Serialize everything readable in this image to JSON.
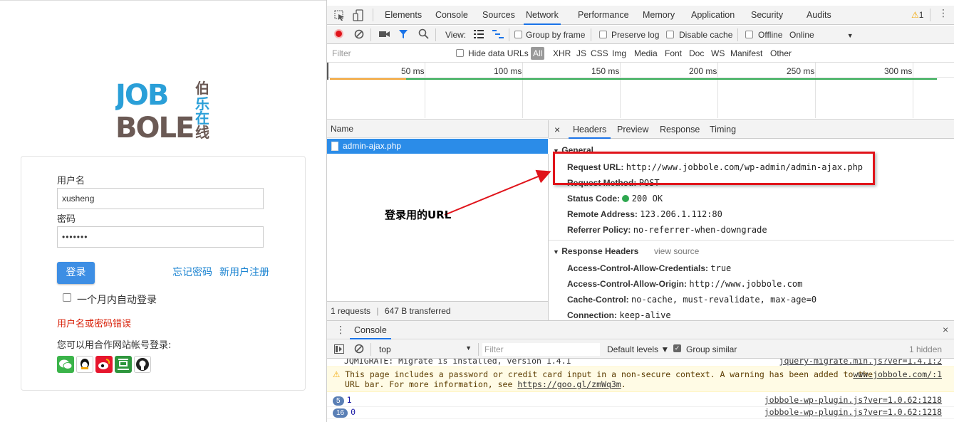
{
  "login": {
    "logo": {
      "line1": "JOB",
      "line2": "BOLE",
      "cn1": "伯乐",
      "cn2": "在线"
    },
    "username_label": "用户名",
    "username_value": "xusheng",
    "password_label": "密码",
    "password_value": "•••••••",
    "login_button": "登录",
    "forgot_link": "忘记密码",
    "register_link": "新用户注册",
    "remember_label": "一个月内自动登录",
    "error_message": "用户名或密码错误",
    "partner_label": "您可以用合作网站帐号登录:",
    "social_icons": [
      "wechat-icon",
      "qq-icon",
      "weibo-icon",
      "douban-icon",
      "github-icon"
    ]
  },
  "devtools": {
    "tabs": [
      "Elements",
      "Console",
      "Sources",
      "Network",
      "Performance",
      "Memory",
      "Application",
      "Security",
      "Audits"
    ],
    "active_tab": "Network",
    "warning_count": "1",
    "toolbar": {
      "view_label": "View:",
      "group_by_frame": "Group by frame",
      "preserve_log": "Preserve log",
      "disable_cache": "Disable cache",
      "offline": "Offline",
      "throttle": "Online"
    },
    "filter_bar": {
      "placeholder": "Filter",
      "hide_data_urls": "Hide data URLs",
      "types": [
        "All",
        "XHR",
        "JS",
        "CSS",
        "Img",
        "Media",
        "Font",
        "Doc",
        "WS",
        "Manifest",
        "Other"
      ]
    },
    "timeline_ticks": [
      "50 ms",
      "100 ms",
      "150 ms",
      "200 ms",
      "250 ms",
      "300 ms"
    ],
    "request_list": {
      "header": "Name",
      "rows": [
        "admin-ajax.php"
      ],
      "status": "1 requests",
      "transferred": "647 B transferred"
    },
    "detail_tabs": [
      "Headers",
      "Preview",
      "Response",
      "Timing"
    ],
    "general": {
      "title": "General",
      "request_url_key": "Request URL:",
      "request_url": "http://www.jobbole.com/wp-admin/admin-ajax.php",
      "request_method_key": "Request Method:",
      "request_method": "POST",
      "status_code_key": "Status Code:",
      "status_code": "200 OK",
      "remote_address_key": "Remote Address:",
      "remote_address": "123.206.1.112:80",
      "referrer_policy_key": "Referrer Policy:",
      "referrer_policy": "no-referrer-when-downgrade"
    },
    "response_headers": {
      "title": "Response Headers",
      "view_source": "view source",
      "rows": [
        {
          "key": "Access-Control-Allow-Credentials:",
          "value": "true"
        },
        {
          "key": "Access-Control-Allow-Origin:",
          "value": "http://www.jobbole.com"
        },
        {
          "key": "Cache-Control:",
          "value": "no-cache, must-revalidate, max-age=0"
        },
        {
          "key": "Connection:",
          "value": "keep-alive"
        }
      ]
    },
    "console": {
      "drawer_tab": "Console",
      "context": "top",
      "filter_placeholder": "Filter",
      "levels": "Default levels ▼",
      "group_similar": "Group similar",
      "hidden": "1 hidden",
      "lines": [
        {
          "text": "JQMIGRATE: Migrate is installed, version 1.4.1",
          "src": "jquery-migrate.min.js?ver=1.4.1:2"
        },
        {
          "text": "This page includes a password or credit card input in a non-secure context. A warning has been added to the",
          "text2": "URL bar. For more information, see ",
          "link": "https://goo.gl/zmWq3m",
          "link_suffix": ".",
          "src": "www.jobbole.com/:1"
        },
        {
          "badge": "5",
          "text": "1",
          "src": "jobbole-wp-plugin.js?ver=1.0.62:1218"
        },
        {
          "badge": "16",
          "text": "0",
          "src": "jobbole-wp-plugin.js?ver=1.0.62:1218"
        }
      ]
    }
  },
  "annotation": {
    "text": "登录用的URL"
  },
  "colors": {
    "accent": "#1a73e8",
    "selected_row": "#2b8ce8",
    "login_button": "#3d8ee4",
    "error": "#d81e06",
    "annotation": "#e0141b"
  }
}
